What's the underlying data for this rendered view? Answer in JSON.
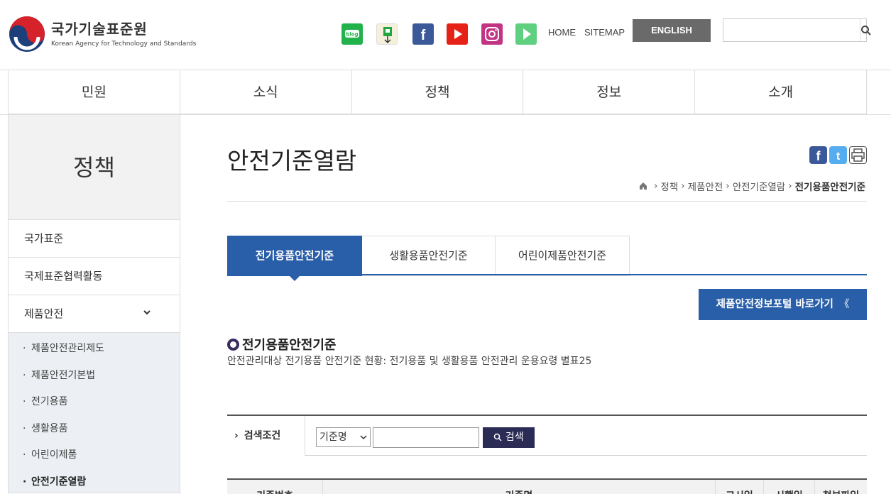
{
  "header": {
    "org_name_ko": "국가기술표준원",
    "org_name_en": "Korean Agency for Technology and Standards",
    "sns": [
      {
        "name": "blog-icon",
        "label": "blog",
        "color": "#22b24c"
      },
      {
        "name": "kakao-story-icon",
        "color": "#f0c319"
      },
      {
        "name": "facebook-icon",
        "color": "#3b5998"
      },
      {
        "name": "youtube-icon",
        "color": "#e62117"
      },
      {
        "name": "instagram-icon",
        "color": "#c13584"
      },
      {
        "name": "play-icon",
        "color": "#5fcf80"
      }
    ],
    "home": "HOME",
    "sitemap": "SITEMAP",
    "english": "ENGLISH",
    "search_placeholder": ""
  },
  "gnb": [
    "민원",
    "소식",
    "정책",
    "정보",
    "소개"
  ],
  "side": {
    "title": "정책",
    "items": [
      "국가표준",
      "국제표준협력활동",
      "제품안전"
    ],
    "sub_items": [
      "제품안전관리제도",
      "제품안전기본법",
      "전기용품",
      "생활용품",
      "어린이제품",
      "안전기준열람"
    ],
    "active_sub": "안전기준열람"
  },
  "content": {
    "page_title": "안전기준열람",
    "breadcrumb": [
      "정책",
      "제품안전",
      "안전기준열람",
      "전기용품안전기준"
    ],
    "tabs": [
      "전기용품안전기준",
      "생활용품안전기준",
      "어린이제품안전기준"
    ],
    "active_tab": "전기용품안전기준",
    "portal_button": "제품안전정보포털 바로가기",
    "portal_arrow": "《",
    "section_title": "전기용품안전기준",
    "section_desc": "안전관리대상 전기용품 안전기준 현황: 전기용품 및 생활용품 안전관리 운용요령 별표25",
    "search": {
      "label": "검색조건",
      "select_value": "기준명",
      "input_value": "",
      "button": "검색"
    },
    "table_headers": [
      "기준번호",
      "기준명",
      "고시일",
      "시행일",
      "첨부파일"
    ]
  },
  "colors": {
    "accent": "#295ea8",
    "search_button": "#2b2c55",
    "english_button": "#6a6a6a"
  }
}
